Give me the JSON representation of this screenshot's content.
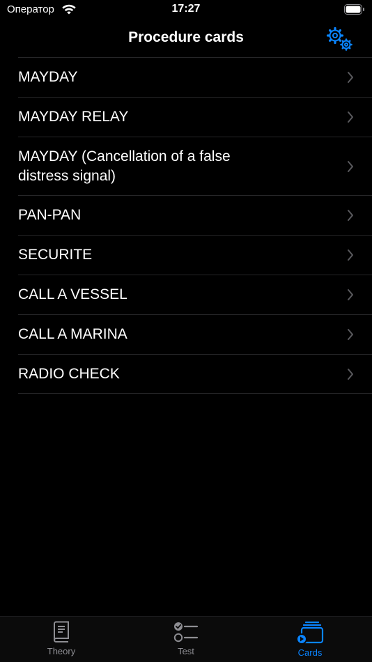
{
  "status_bar": {
    "carrier": "Оператор",
    "time": "17:27",
    "wifi_icon": "wifi-icon",
    "battery_icon": "battery-icon"
  },
  "nav": {
    "title": "Procedure cards",
    "settings_icon": "gears-icon",
    "accent_color": "#0a84ff"
  },
  "procedures": [
    {
      "label": "MAYDAY"
    },
    {
      "label": "MAYDAY RELAY"
    },
    {
      "label": "MAYDAY (Cancellation of a false distress signal)"
    },
    {
      "label": "PAN-PAN"
    },
    {
      "label": "SECURITE"
    },
    {
      "label": "CALL A VESSEL"
    },
    {
      "label": "CALL A MARINA"
    },
    {
      "label": "RADIO CHECK"
    }
  ],
  "tabs": [
    {
      "label": "Theory",
      "icon": "book-icon",
      "active": false
    },
    {
      "label": "Test",
      "icon": "checklist-icon",
      "active": false
    },
    {
      "label": "Cards",
      "icon": "cards-stack-icon",
      "active": true
    }
  ],
  "colors": {
    "background": "#000000",
    "separator": "#262628",
    "inactive_tab": "#8e8e93",
    "active_tab": "#0a84ff"
  }
}
